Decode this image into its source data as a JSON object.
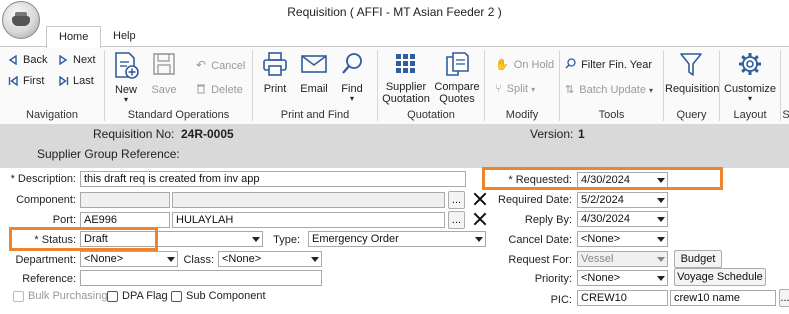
{
  "window": {
    "title": "Requisition ( AFFI - MT Asian Feeder 2 )"
  },
  "tabs": [
    {
      "label": "Home"
    },
    {
      "label": "Help"
    }
  ],
  "ribbon": {
    "navigation": {
      "back": "Back",
      "next": "Next",
      "first": "First",
      "last": "Last",
      "label": "Navigation"
    },
    "standard_operations": {
      "new": "New",
      "save": "Save",
      "cancel": "Cancel",
      "delete": "Delete",
      "label": "Standard Operations"
    },
    "print_find": {
      "print": "Print",
      "email": "Email",
      "find": "Find",
      "label": "Print and Find"
    },
    "quotation": {
      "supplier_quotation_1": "Supplier",
      "supplier_quotation_2": "Quotation",
      "compare_quotes_1": "Compare",
      "compare_quotes_2": "Quotes",
      "label": "Quotation"
    },
    "modify": {
      "on_hold": "On Hold",
      "split": "Split",
      "label": "Modify"
    },
    "tools": {
      "filter_fin_year": "Filter Fin. Year",
      "batch_update": "Batch Update",
      "label": "Tools"
    },
    "query": {
      "requisition": "Requisition",
      "label": "Query"
    },
    "layout": {
      "customize": "Customize",
      "label": "Layout"
    },
    "overflow": "S"
  },
  "header": {
    "requisition_no_label": "Requisition No:",
    "requisition_no": "24R-0005",
    "version_label": "Version:",
    "version": "1",
    "supplier_group_label": "Supplier Group Reference:"
  },
  "form": {
    "description_label": "* Description:",
    "description": "this draft req is created from inv app",
    "component_label": "Component:",
    "port_label": "Port:",
    "port_code": "AE996",
    "port_name": "HULAYLAH",
    "status_label": "* Status:",
    "status": "Draft",
    "type_label": "Type:",
    "type": "Emergency Order",
    "department_label": "Department:",
    "department": "<None>",
    "class_label": "Class:",
    "class": "<None>",
    "reference_label": "Reference:",
    "bulk_purchasing_label": "Bulk Purchasing",
    "dpa_flag_label": "DPA Flag",
    "sub_component_label": "Sub Component",
    "requested_label": "* Requested:",
    "requested": "4/30/2024",
    "required_date_label": "Required Date:",
    "required_date": "5/2/2024",
    "reply_by_label": "Reply By:",
    "reply_by": "4/30/2024",
    "cancel_date_label": "Cancel Date:",
    "cancel_date": "<None>",
    "request_for_label": "Request For:",
    "request_for": "Vessel",
    "priority_label": "Priority:",
    "priority": "<None>",
    "pic_label": "PIC:",
    "pic_code": "CREW10",
    "pic_name": "crew10 name",
    "ellipsis": "...",
    "budget_button": "Budget",
    "voyage_schedule_button": "Voyage Schedule"
  },
  "colors": {
    "highlight": "#f0842c",
    "ribbon_icon_blue": "#2f5d9e",
    "band": "#d9d9d9"
  }
}
